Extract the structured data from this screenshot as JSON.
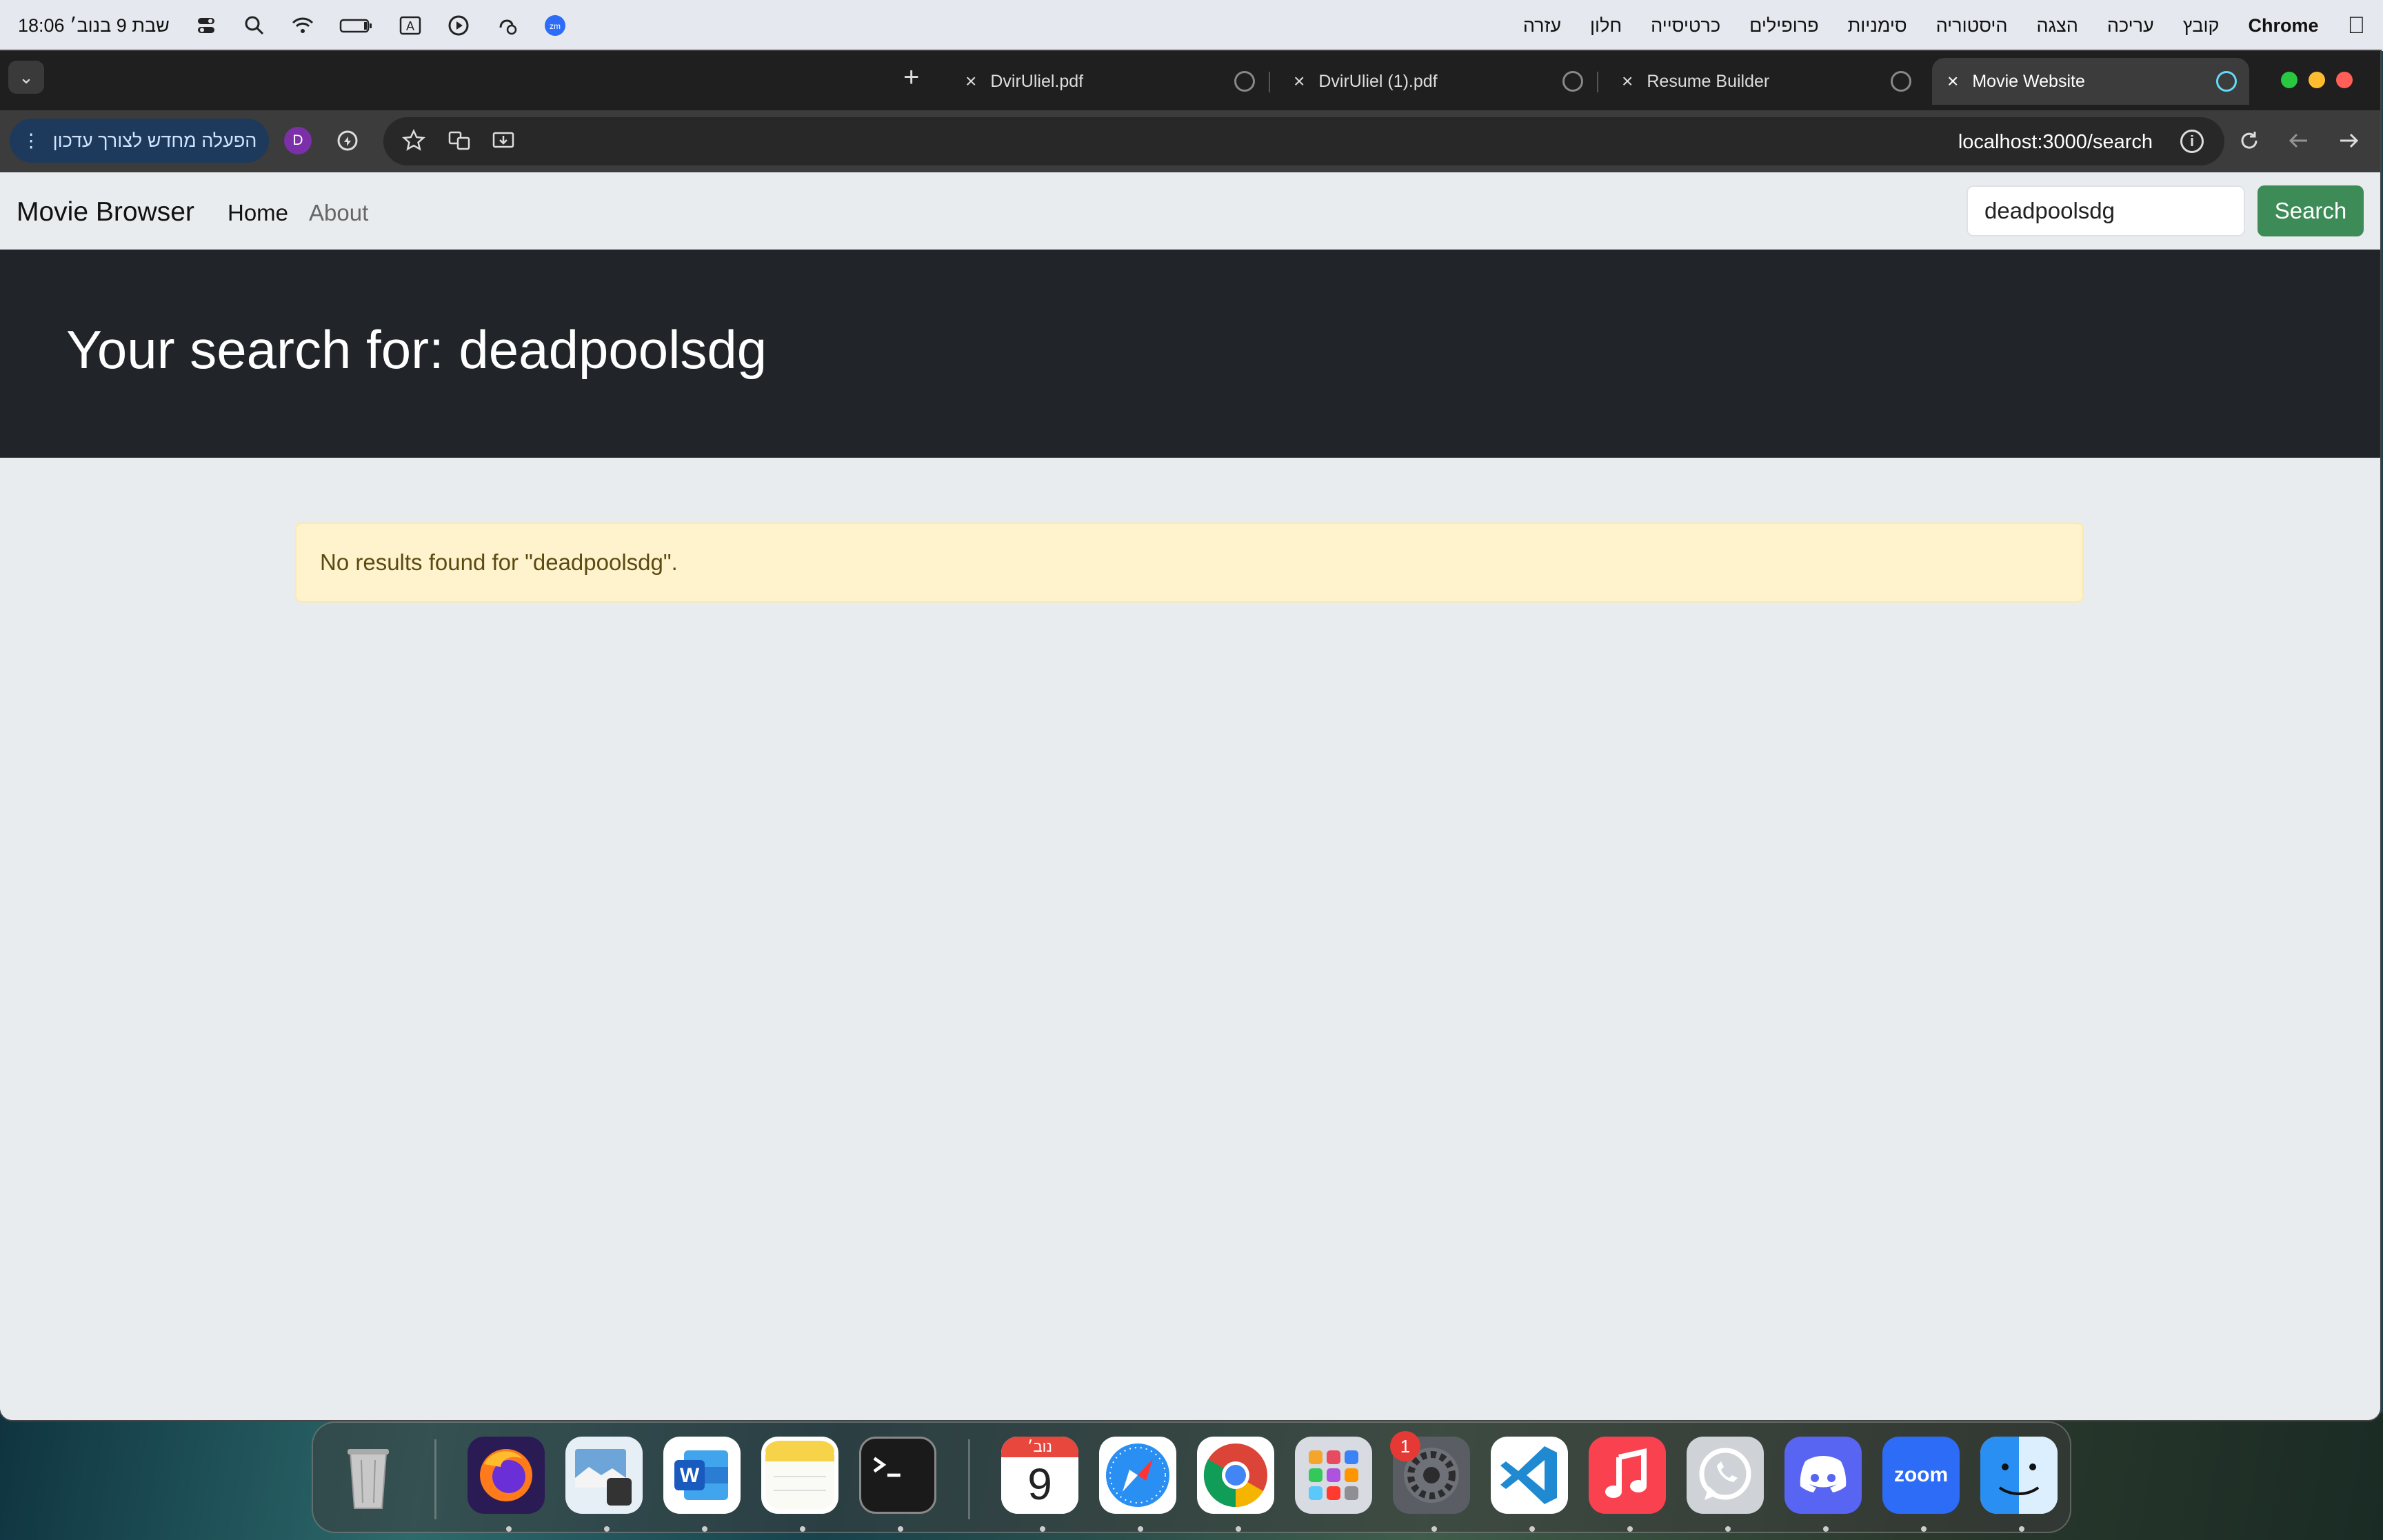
{
  "menubar": {
    "app_name": "Chrome",
    "menus": [
      "קובץ",
      "עריכה",
      "הצגה",
      "היסטוריה",
      "סימניות",
      "פרופילים",
      "כרטיסייה",
      "חלון",
      "עזרה"
    ],
    "clock": "שבת 9 בנוב׳  18:06",
    "input_source": "A",
    "zoom_label": "zm"
  },
  "browser": {
    "tabs": [
      {
        "title": "Movie Website"
      },
      {
        "title": "Resume Builder"
      },
      {
        "title": "DvirUliel (1).pdf"
      },
      {
        "title": "DvirUliel.pdf"
      }
    ],
    "new_tab": "+",
    "update_button": "הפעלה מחדש לצורך עדכון",
    "profile_initial": "D",
    "url": "localhost:3000/search"
  },
  "page": {
    "brand": "Movie Browser",
    "nav": {
      "home": "Home",
      "about": "About"
    },
    "search": {
      "value": "deadpoolsdg",
      "button": "Search"
    },
    "heading": "Your search for: deadpoolsdg",
    "alert": "No results found for \"deadpoolsdg\"."
  },
  "dock": {
    "calendar_month": "נוב׳",
    "calendar_day": "9",
    "settings_badge": "1",
    "zoom_label": "zoom",
    "apps": [
      "Trash",
      "Firefox",
      "Preview",
      "Word",
      "Notes",
      "Terminal",
      "Calendar",
      "Safari",
      "Chrome",
      "Launchpad",
      "System Settings",
      "VS Code",
      "Music",
      "WhatsApp",
      "Discord",
      "Zoom",
      "Finder"
    ]
  },
  "colors": {
    "hero_bg": "#212529",
    "search_button": "#3d8b57",
    "alert_bg": "#fff3cd",
    "page_bg": "#e9ecef"
  }
}
